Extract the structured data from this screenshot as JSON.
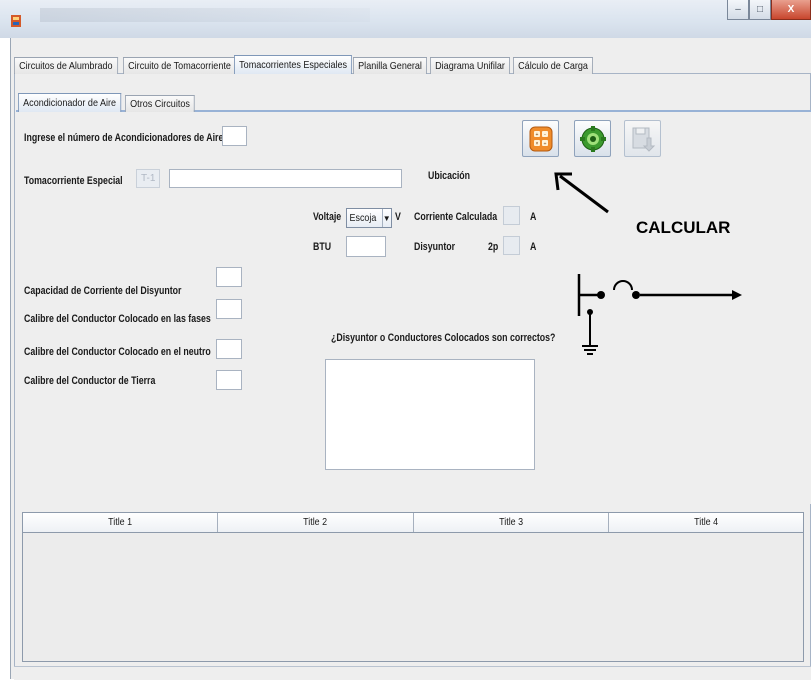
{
  "colors": {
    "window_bg": "#eeeeee",
    "tab_active_accent": "#7e97b8",
    "calc_button_accent": "#f08c2a",
    "gear_button_accent": "#3c9a2e",
    "close_button": "#c8462d"
  },
  "window": {
    "icons": [
      "java-app-icon"
    ],
    "controls": [
      "minimize-icon",
      "maximize-icon",
      "close-icon"
    ],
    "close_label": "X"
  },
  "tabs": [
    {
      "label": "Circuitos de Alumbrado"
    },
    {
      "label": "Circuito de Tomacorriente"
    },
    {
      "label": "Tomacorrientes Especiales",
      "active": true
    },
    {
      "label": "Planilla General"
    },
    {
      "label": "Diagrama Unifilar"
    },
    {
      "label": "Cálculo de Carga"
    }
  ],
  "subtabs": [
    {
      "label": "Acondicionador de Aire",
      "active": true
    },
    {
      "label": "Otros Circuitos"
    }
  ],
  "form": {
    "num_acondicionadores_label": "Ingrese el número de Acondicionadores de Aire:",
    "num_acondicionadores_value": "",
    "toma_especial_label": "Tomacorriente Especial",
    "toma_especial_hint": "T-1",
    "ubicacion_value": "",
    "ubicacion_label": "Ubicación",
    "voltaje_label": "Voltaje",
    "voltaje_selected": "Escoja",
    "voltaje_unit": "V",
    "corriente_calculada_label": "Corriente Calculada",
    "corriente_unit": "A",
    "btu_label": "BTU",
    "btu_value": "",
    "disyuntor_label": "Disyuntor",
    "disyuntor_poles": "2p",
    "disyuntor_unit": "A",
    "capacidad_label": "Capacidad de Corriente del Disyuntor",
    "calibre_fases_label": "Calibre del Conductor Colocado en las fases",
    "calibre_neutro_label": "Calibre del Conductor Colocado en el neutro",
    "calibre_tierra_label": "Calibre del Conductor de Tierra",
    "pregunta_label": "¿Disyuntor o Conductores Colocados son correctos?",
    "pregunta_value": ""
  },
  "toolbar": {
    "buttons": [
      {
        "icon": "calculator-icon",
        "enabled": true
      },
      {
        "icon": "gear-icon",
        "enabled": true
      },
      {
        "icon": "save-icon",
        "enabled": false
      }
    ]
  },
  "annotation": {
    "label": "CALCULAR"
  },
  "table": {
    "headers": [
      "Title 1",
      "Title 2",
      "Title 3",
      "Title 4"
    ],
    "rows": []
  }
}
